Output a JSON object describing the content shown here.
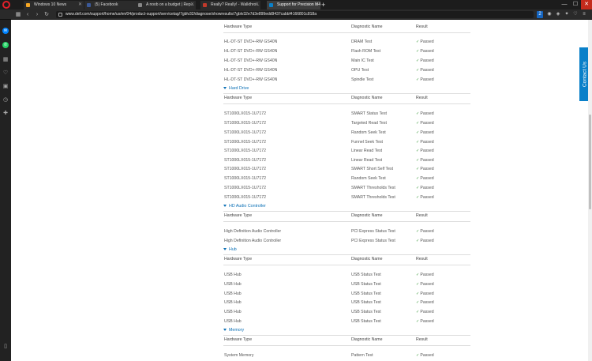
{
  "browser": {
    "tabs": [
      {
        "label": "Windows 10 News",
        "color": "#f5a623"
      },
      {
        "label": "(5) Facebook",
        "color": "#3b5998"
      },
      {
        "label": "A noob on a budget | Rep...",
        "color": "#888888"
      },
      {
        "label": "Really? Really! - Walkthro...",
        "color": "#c0392b"
      },
      {
        "label": "Support for Precision M4...",
        "color": "#0a80c9"
      }
    ],
    "url": "www.dell.com/support/home/us/en/04/product-support/servicetag/7gblv32/diagnose/showresults/7gblv32e7d3e899edd9437cabbf4166801c818a",
    "ext_badge": "2"
  },
  "contact_label": "Contact Us",
  "sections": [
    {
      "name": null,
      "header": [
        "Hardware Type",
        "Diagnostic Name",
        "Result"
      ],
      "rows": [
        [
          "HL-DT-ST DVD+-RW GS40N",
          "DRAM Test",
          "Passed"
        ],
        [
          "HL-DT-ST DVD+-RW GS40N",
          "Flash ROM Test",
          "Passed"
        ],
        [
          "HL-DT-ST DVD+-RW GS40N",
          "Main IC Test",
          "Passed"
        ],
        [
          "HL-DT-ST DVD+-RW GS40N",
          "OPU Test",
          "Passed"
        ],
        [
          "HL-DT-ST DVD+-RW GS40N",
          "Spindle Test",
          "Passed"
        ]
      ]
    },
    {
      "name": "Hard Drive",
      "header": [
        "Hardware Type",
        "Diagnostic Name",
        "Result"
      ],
      "rows": [
        [
          "ST1000LX015-1U7172",
          "SMART Status Test",
          "Passed"
        ],
        [
          "ST1000LX015-1U7172",
          "Targeted Read Test",
          "Passed"
        ],
        [
          "ST1000LX015-1U7172",
          "Random Seek Test",
          "Passed"
        ],
        [
          "ST1000LX015-1U7172",
          "Funnel Seek Test",
          "Passed"
        ],
        [
          "ST1000LX015-1U7172",
          "Linear Read Test",
          "Passed"
        ],
        [
          "ST1000LX015-1U7172",
          "Linear Read Test",
          "Passed"
        ],
        [
          "ST1000LX015-1U7172",
          "SMART Short Self Test",
          "Passed"
        ],
        [
          "ST1000LX015-1U7172",
          "Random Seek Test",
          "Passed"
        ],
        [
          "ST1000LX015-1U7172",
          "SMART Thresholds Test",
          "Passed"
        ],
        [
          "ST1000LX015-1U7172",
          "SMART Thresholds Test",
          "Passed"
        ]
      ]
    },
    {
      "name": "HD Audio Controller",
      "header": [
        "Hardware Type",
        "Diagnostic Name",
        "Result"
      ],
      "rows": [
        [
          "High Definition Audio Controller",
          "PCI Express Status Test",
          "Passed"
        ],
        [
          "High Definition Audio Controller",
          "PCI Express Status Test",
          "Passed"
        ]
      ]
    },
    {
      "name": "Hub",
      "header": [
        "Hardware Type",
        "Diagnostic Name",
        "Result"
      ],
      "rows": [
        [
          "USB Hub",
          "USB Status Test",
          "Passed"
        ],
        [
          "USB Hub",
          "USB Status Test",
          "Passed"
        ],
        [
          "USB Hub",
          "USB Status Test",
          "Passed"
        ],
        [
          "USB Hub",
          "USB Status Test",
          "Passed"
        ],
        [
          "USB Hub",
          "USB Status Test",
          "Passed"
        ],
        [
          "USB Hub",
          "USB Status Test",
          "Passed"
        ]
      ]
    },
    {
      "name": "Memory",
      "header": [
        "Hardware Type",
        "Diagnostic Name",
        "Result"
      ],
      "rows": [
        [
          "System Memory",
          "Pattern Test",
          "Passed"
        ]
      ]
    }
  ]
}
